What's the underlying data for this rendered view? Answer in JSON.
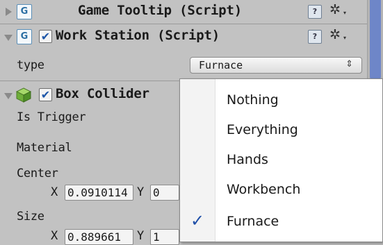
{
  "components": {
    "game_tooltip": {
      "title": "Game Tooltip (Script)",
      "expanded": false
    },
    "work_station": {
      "title": "Work Station (Script)",
      "enabled": true,
      "expanded": true,
      "type_label": "type",
      "type_value": "Furnace"
    },
    "box_collider": {
      "title": "Box Collider",
      "enabled": true,
      "expanded": true,
      "is_trigger_label": "Is Trigger",
      "material_label": "Material",
      "center_label": "Center",
      "center": {
        "x_label": "X",
        "x_value": "0.0910114",
        "y_label": "Y",
        "y_value": "0"
      },
      "size_label": "Size",
      "size": {
        "x_label": "X",
        "x_value": "0.889661",
        "y_label": "Y",
        "y_value": "1"
      }
    }
  },
  "icons": {
    "script": "G",
    "help": "?",
    "gear": "✲",
    "gear_arrow": "▾",
    "check": "✔",
    "select_arrow": "⇕"
  },
  "dropdown": {
    "items": [
      "Nothing",
      "Everything",
      "Hands",
      "Workbench",
      "Furnace"
    ],
    "selected": "Furnace",
    "check_mark": "✓"
  },
  "colors": {
    "panel_bg": "#c2c2c2",
    "menu_bg": "#ffffff",
    "check_blue": "#1f4fa8",
    "scroll_thumb": "#6e86c8"
  }
}
